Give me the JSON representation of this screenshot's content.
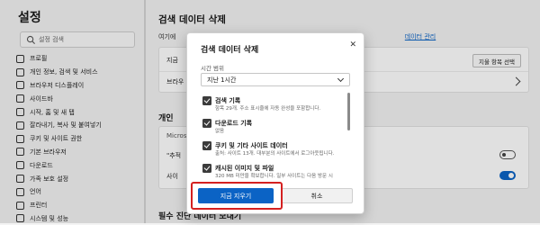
{
  "sidebar": {
    "title": "설정",
    "search_placeholder": "설정 검색",
    "items": [
      {
        "label": "프로필",
        "icon": "profile-icon"
      },
      {
        "label": "개인 정보, 검색 및 서비스",
        "icon": "lock-icon"
      },
      {
        "label": "브라우저 디스플레이",
        "icon": "appearance-icon"
      },
      {
        "label": "사이드바",
        "icon": "sidebar-icon"
      },
      {
        "label": "시작, 홈 및 새 탭",
        "icon": "home-icon"
      },
      {
        "label": "잘라내기, 복사 및 붙여넣기",
        "icon": "clipboard-icon"
      },
      {
        "label": "쿠키 및 사이트 권한",
        "icon": "cookie-icon"
      },
      {
        "label": "기본 브라우저",
        "icon": "browser-icon"
      },
      {
        "label": "다운로드",
        "icon": "download-icon"
      },
      {
        "label": "가족 보호 설정",
        "icon": "family-icon"
      },
      {
        "label": "언어",
        "icon": "language-icon"
      },
      {
        "label": "프린터",
        "icon": "printer-icon"
      },
      {
        "label": "시스템 및 성능",
        "icon": "system-icon"
      }
    ]
  },
  "main": {
    "heading": "검색 데이터 삭제",
    "description": "여기에",
    "description_link": "데이터 관리",
    "row1_label": "지금",
    "choose_button": "지울 항목 선택",
    "row2_label": "브라우",
    "section2_heading": "개인",
    "section2_row1": "Micros",
    "section2_row2": "\"추적",
    "section2_row3": "사이",
    "section3_heading": "필수 진단 데이터 보내기",
    "toggle_off": false,
    "toggle_on": true
  },
  "dialog": {
    "title": "검색 데이터 삭제",
    "close_glyph": "✕",
    "time_range_label": "시간 범위",
    "time_range_value": "지난 1시간",
    "options": [
      {
        "title": "검색 기록",
        "subtitle": "항목 29개. 주소 표시줄에 자동 완성을 포함합니다.",
        "checked": true
      },
      {
        "title": "다운로드 기록",
        "subtitle": "없음",
        "checked": true
      },
      {
        "title": "쿠키 및 기타 사이트 데이터",
        "subtitle": "출처: 사이트 13개. 대부분의 사이트에서 로그아웃됩니다.",
        "checked": true
      },
      {
        "title": "캐시된 이미지 및 파일",
        "subtitle": "320 MB 미만을 확보합니다. 일부 사이트는 다음 방문 시",
        "checked": true
      }
    ],
    "primary_button": "지금 지우기",
    "secondary_button": "취소"
  },
  "colors": {
    "accent": "#0b63c5",
    "highlight_border": "#d42020"
  }
}
